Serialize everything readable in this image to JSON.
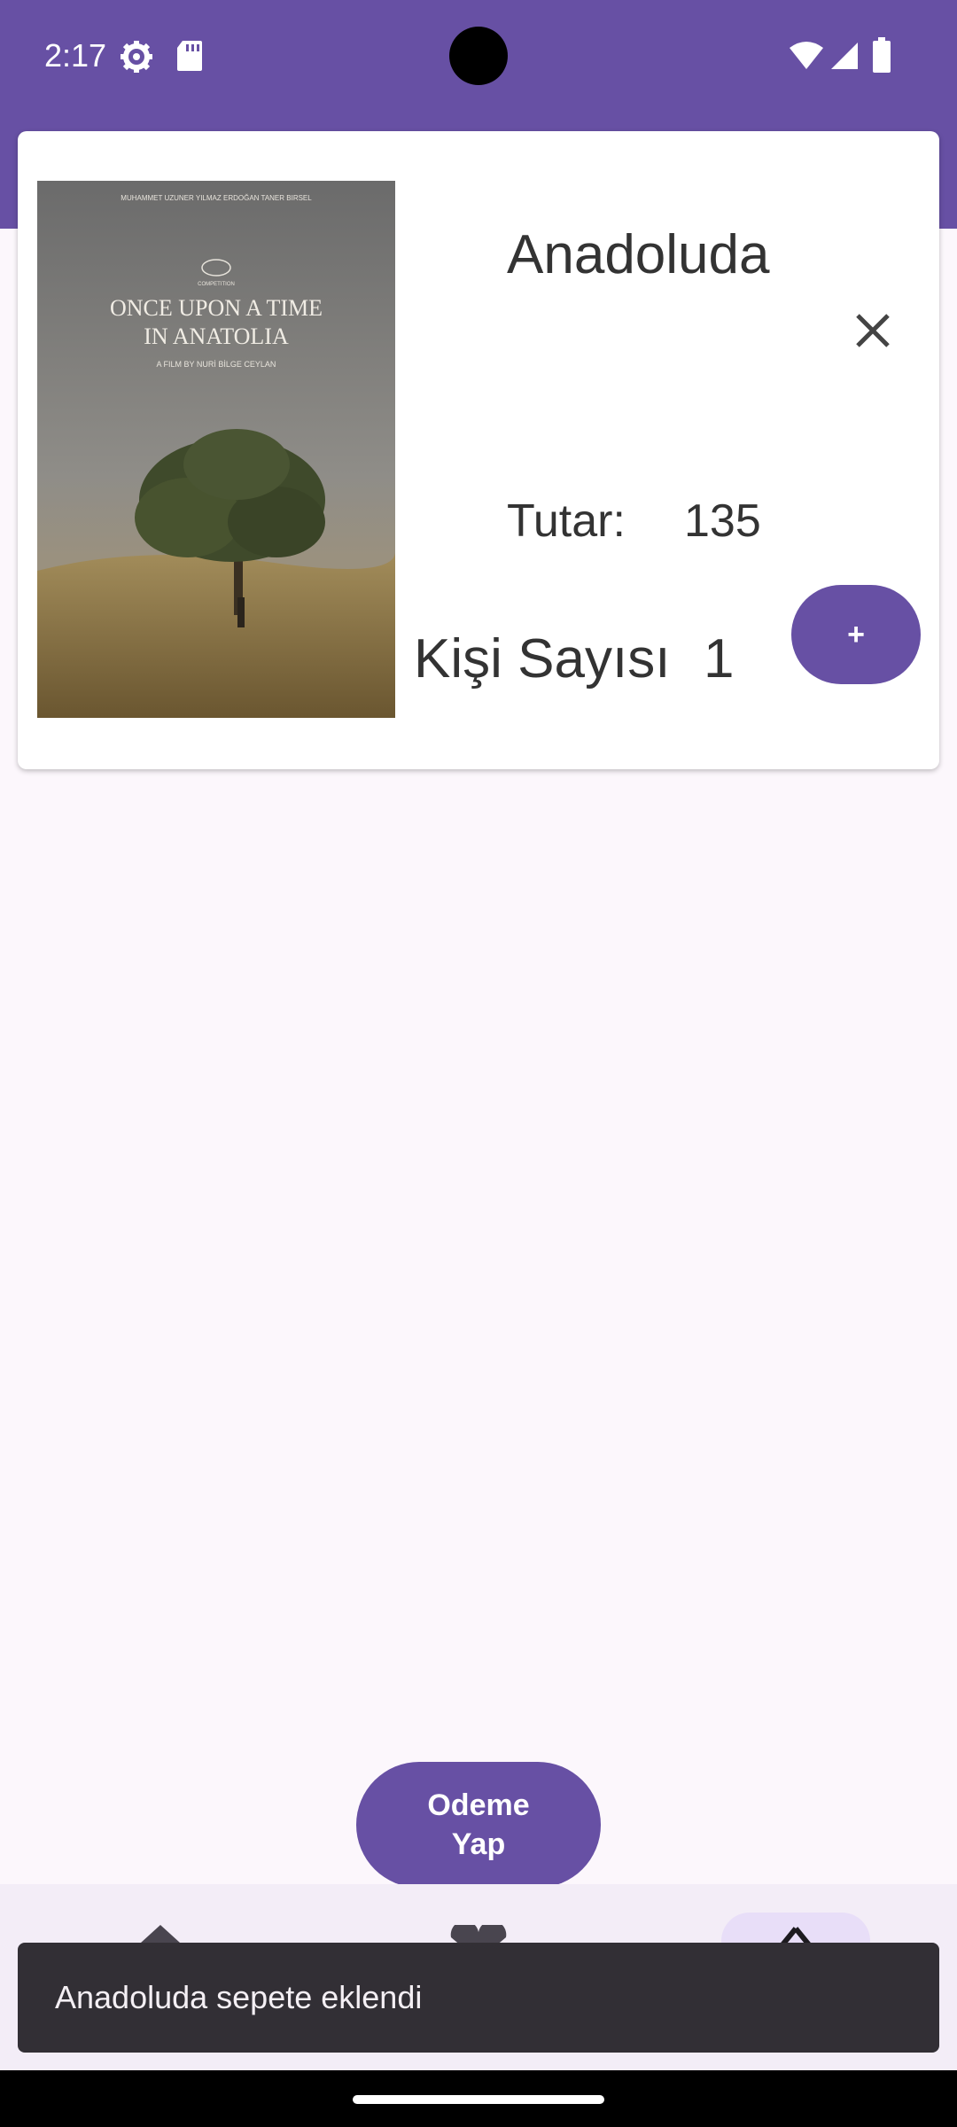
{
  "status_bar": {
    "time": "2:17",
    "icons": [
      "settings-icon",
      "sd-card-icon",
      "wifi-icon",
      "signal-icon",
      "battery-icon"
    ],
    "background": "#6750a4"
  },
  "cart_item": {
    "title": "Anadoluda",
    "poster": {
      "credits": "MUHAMMET UZUNER   YILMAZ ERDOĞAN   TANER BIRSEL",
      "festival": "COMPETITION",
      "title_line1": "ONCE UPON A TIME",
      "title_line2": "IN ANATOLIA",
      "director": "A FILM BY NURİ BİLGE CEYLAN"
    },
    "price_label": "Tutar:",
    "price_value": "135",
    "count_label": "Kişi Sayısı",
    "count_value": "1",
    "increment_label": "+",
    "close_icon": "close-icon"
  },
  "pay_button": {
    "label": "Odeme Yap"
  },
  "bottom_nav": {
    "items": [
      {
        "icon": "home-icon"
      },
      {
        "icon": "heart-icon"
      },
      {
        "icon": "cart-icon",
        "selected": true
      }
    ]
  },
  "snackbar": {
    "text": "Anadoluda sepete eklendi"
  },
  "colors": {
    "primary": "#6750a4",
    "background": "#fcf7fc",
    "snackbar": "#322f35"
  }
}
